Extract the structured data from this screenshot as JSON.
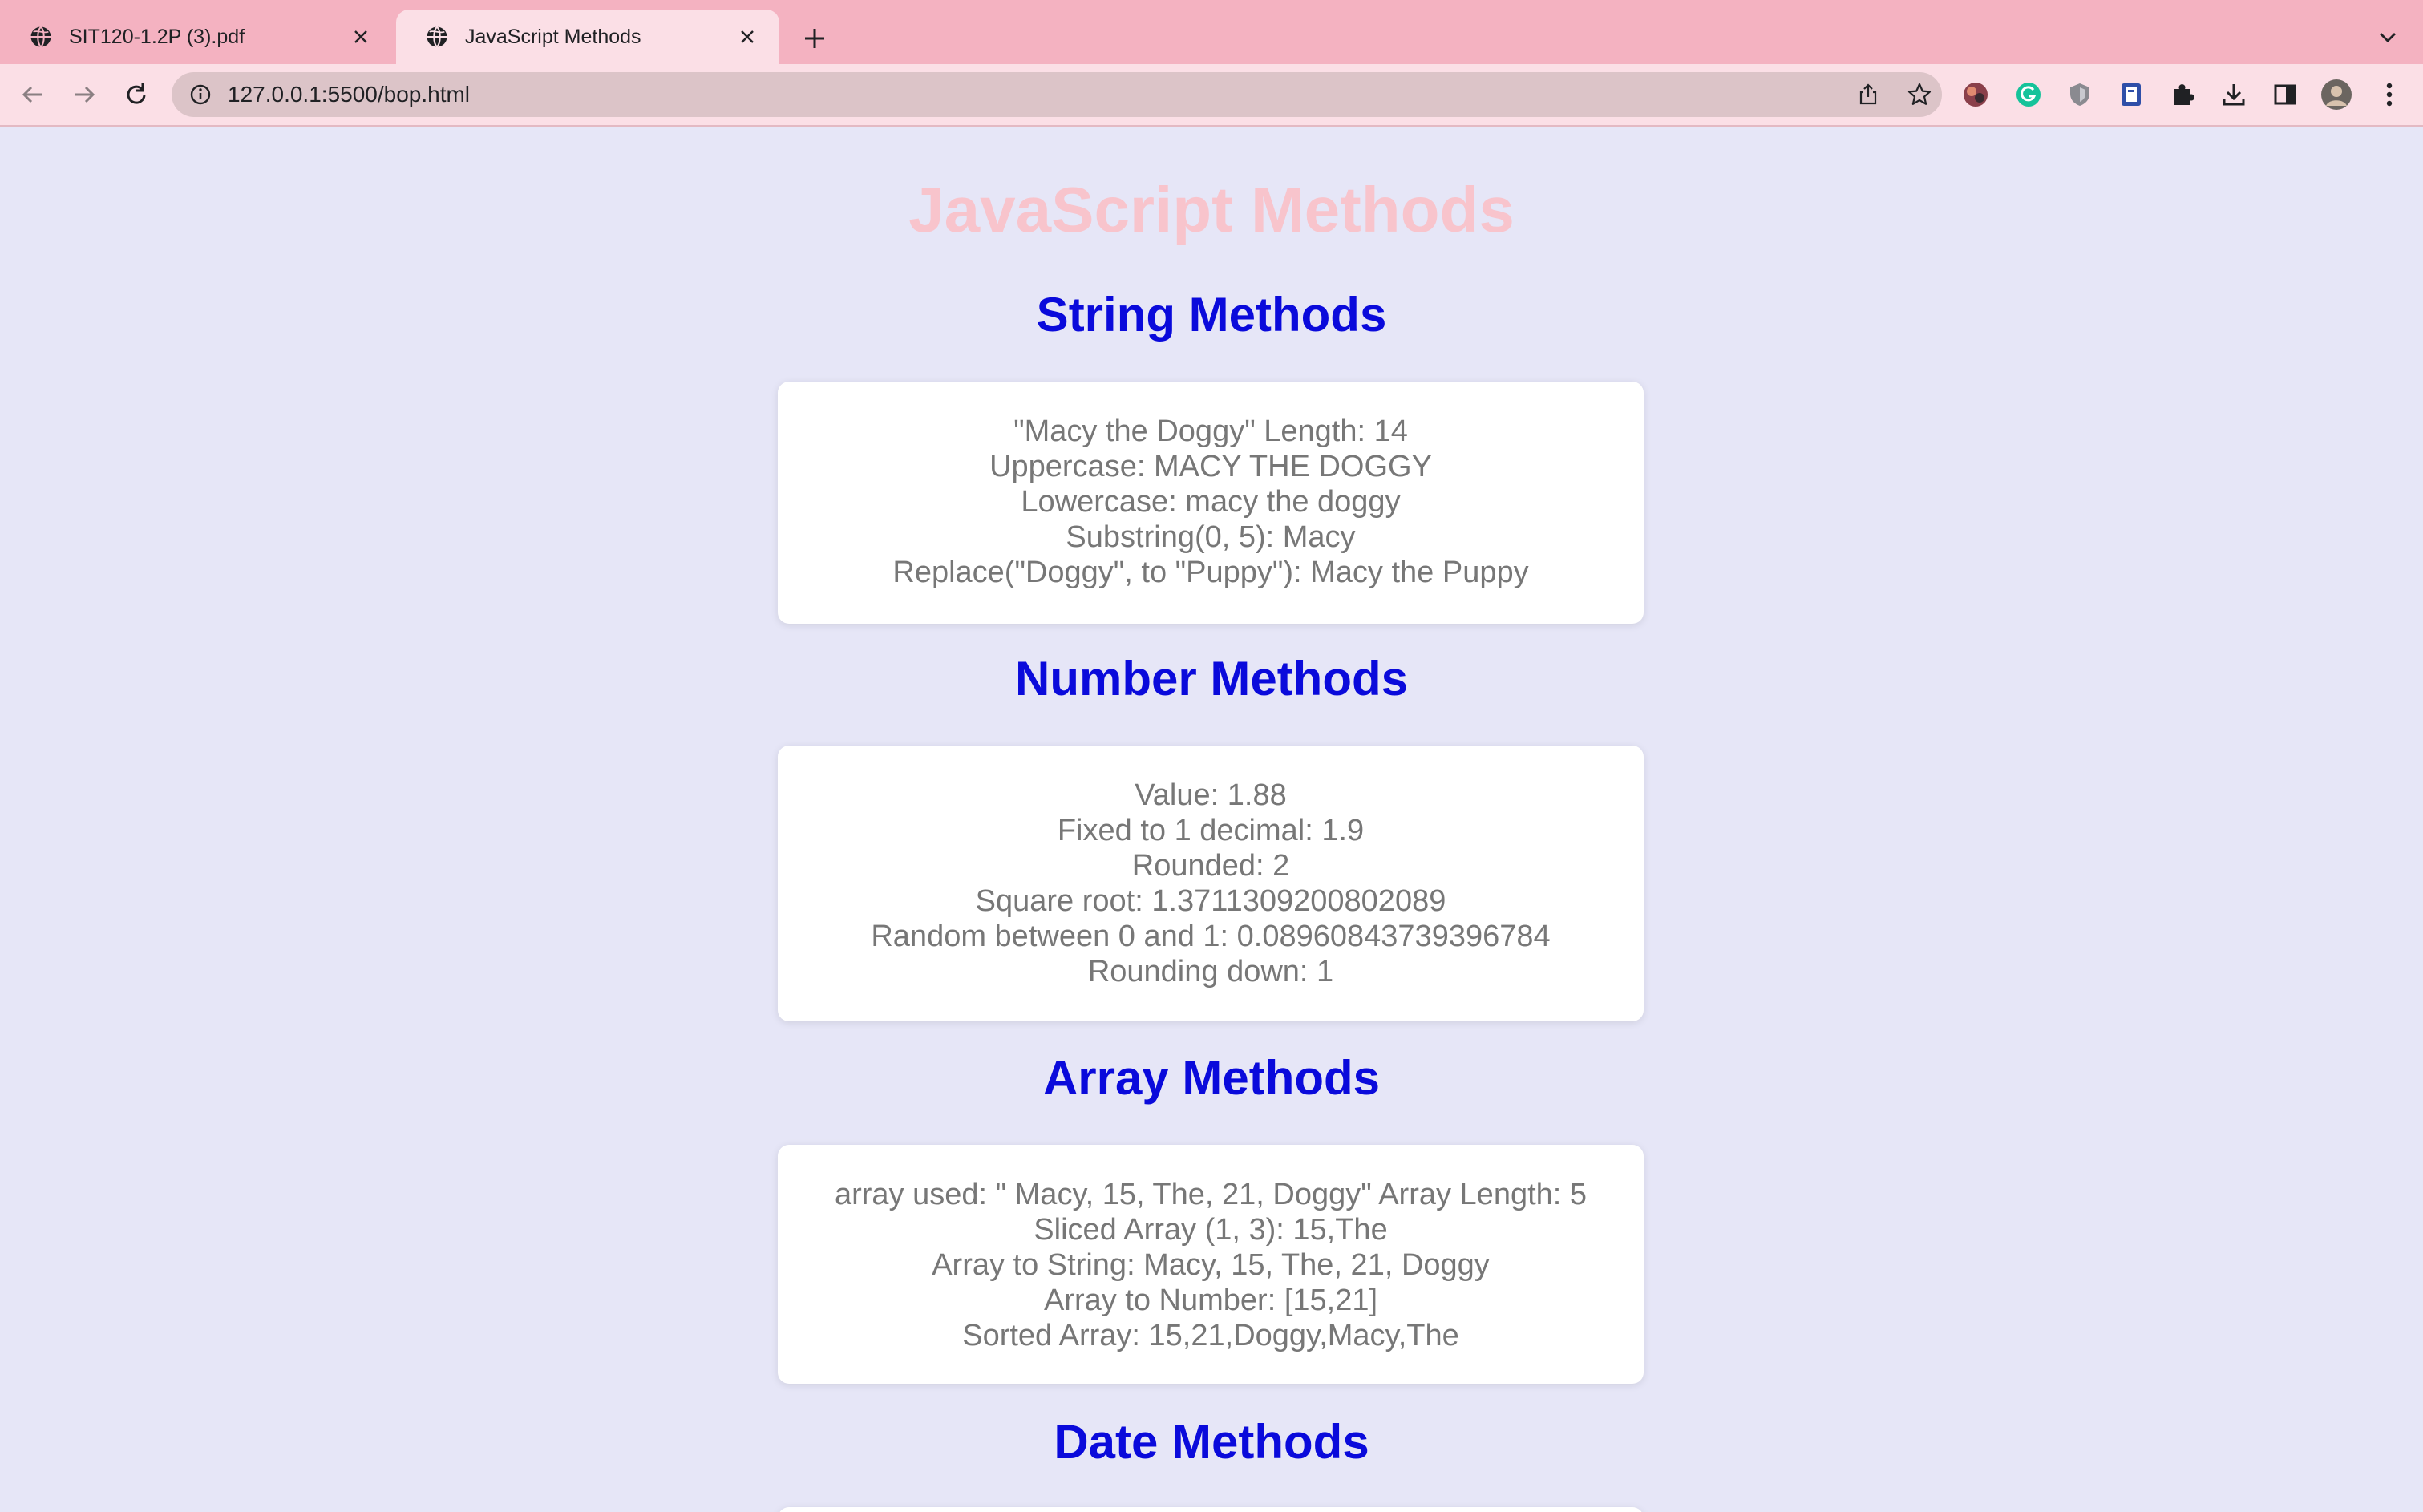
{
  "browser": {
    "tabs": [
      {
        "title": "SIT120-1.2P (3).pdf",
        "active": false
      },
      {
        "title": "JavaScript Methods",
        "active": true
      }
    ],
    "address": {
      "host": "127.0.0.1",
      "rest": ":5500/bop.html"
    },
    "icons": [
      "globe-icon",
      "close-icon",
      "plus-icon",
      "chevron-down-icon",
      "back-icon",
      "forward-icon",
      "reload-icon",
      "info-icon",
      "share-icon",
      "star-icon",
      "puzzle-icon",
      "download-icon",
      "side-panel-icon",
      "avatar",
      "more-vert-icon"
    ]
  },
  "page": {
    "title": "JavaScript Methods",
    "sections": [
      {
        "heading": "String Methods",
        "lines": [
          "\"Macy the Doggy\" Length: 14",
          "Uppercase: MACY THE DOGGY",
          "Lowercase: macy the doggy",
          "Substring(0, 5): Macy",
          "Replace(\"Doggy\", to \"Puppy\"): Macy the Puppy"
        ]
      },
      {
        "heading": "Number Methods",
        "lines": [
          "Value: 1.88",
          "Fixed to 1 decimal: 1.9",
          "Rounded: 2",
          "Square root: 1.3711309200802089",
          "Random between 0 and 1: 0.08960843739396784",
          "Rounding down: 1"
        ]
      },
      {
        "heading": "Array Methods",
        "lines": [
          "array used: \" Macy, 15, The, 21, Doggy\" Array Length: 5",
          "Sliced Array (1, 3): 15,The",
          "Array to String: Macy, 15, The, 21, Doggy",
          "Array to Number: [15,21]",
          "Sorted Array: 15,21,Doggy,Macy,The"
        ]
      },
      {
        "heading": "Date Methods",
        "lines": []
      }
    ]
  },
  "colors": {
    "tabstrip": "#f4b2c1",
    "toolbar": "#fbdfe6",
    "page_bg": "#e6e6f7",
    "title": "#f8c4cc",
    "heading": "#0a0adb",
    "card_text": "#777777"
  }
}
